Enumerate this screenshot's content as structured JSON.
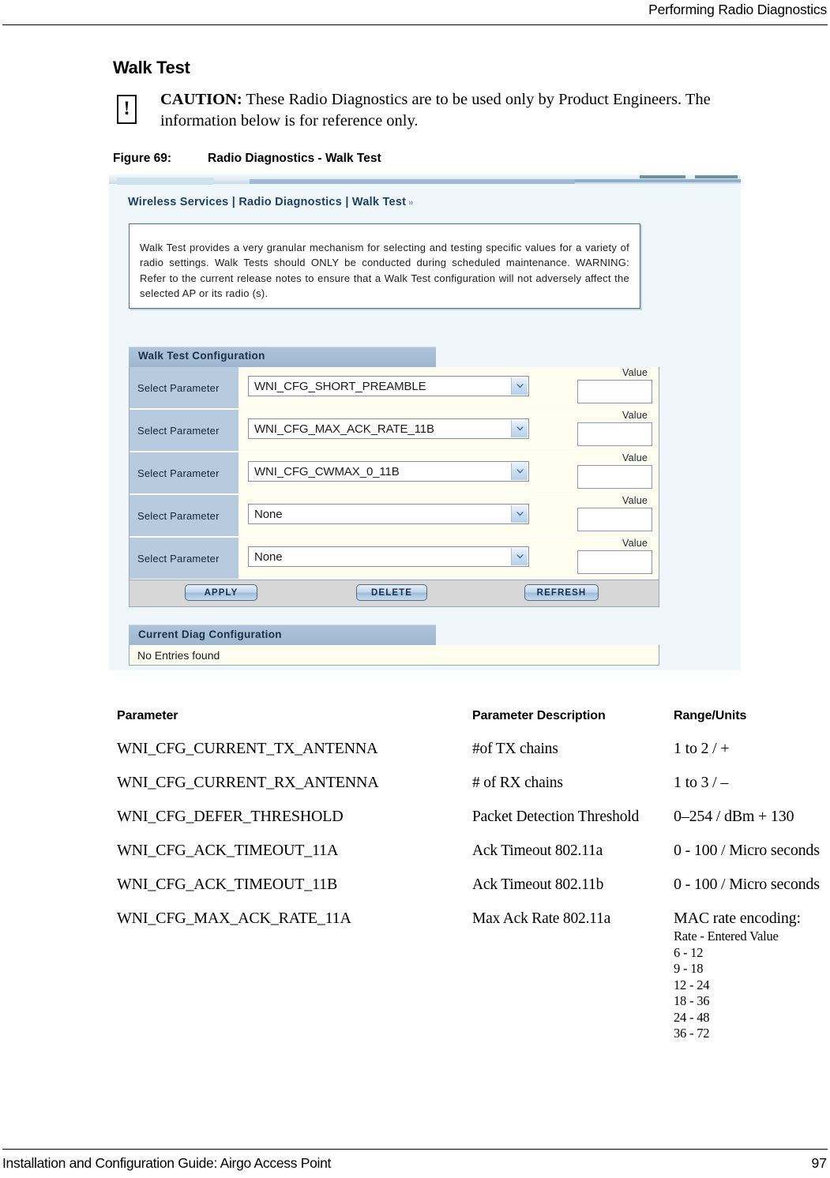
{
  "page": {
    "running_head": "Performing Radio Diagnostics",
    "section_title": "Walk Test",
    "footer_left": "Installation and Configuration Guide: Airgo Access Point",
    "footer_page_number": "97"
  },
  "caution": {
    "icon": "exclamation-icon",
    "glyph": "!",
    "lead": "CAUTION:",
    "body": " These Radio Diagnostics are to be used only by Product Engineers. The information below is for reference only."
  },
  "figure": {
    "number": "Figure 69:",
    "title": "Radio Diagnostics - Walk Test"
  },
  "screenshot": {
    "breadcrumb": "Wireless Services | Radio Diagnostics | Walk Test",
    "breadcrumb_chevron": "»",
    "intro_text": "Walk Test provides a very granular mechanism for selecting and testing specific values for a variety of radio settings. Walk Tests should ONLY be conducted during scheduled maintenance. WARNING: Refer to the current release notes to ensure that a Walk Test configuration will not adversely affect the selected AP or its radio (s).",
    "config_panel": {
      "title": "Walk Test Configuration",
      "value_caption": "Value",
      "rows": [
        {
          "label": "Select Parameter",
          "selected": "WNI_CFG_SHORT_PREAMBLE",
          "value": ""
        },
        {
          "label": "Select Parameter",
          "selected": "WNI_CFG_MAX_ACK_RATE_11B",
          "value": ""
        },
        {
          "label": "Select Parameter",
          "selected": "WNI_CFG_CWMAX_0_11B",
          "value": ""
        },
        {
          "label": "Select Parameter",
          "selected": "None",
          "value": ""
        },
        {
          "label": "Select Parameter",
          "selected": "None",
          "value": ""
        }
      ],
      "buttons": {
        "apply": "APPLY",
        "delete": "DELETE",
        "refresh": "REFRESH"
      }
    },
    "diag_panel": {
      "title": "Current Diag Configuration",
      "empty_message": "No Entries found"
    },
    "colors": {
      "page_background": "#f0f7fb",
      "panel_header": "#a5bed6",
      "row_label": "#b7cade",
      "field_background": "#fffdf0",
      "breadcrumb_text": "#1d3f63",
      "button_border": "#4e6a8c"
    }
  },
  "parameter_table": {
    "headers": [
      "Parameter",
      "Parameter Description",
      "Range/Units"
    ],
    "rows": [
      {
        "parameter": "WNI_CFG_CURRENT_TX_ANTENNA",
        "description": "#of TX chains",
        "range": "1 to 2 / +"
      },
      {
        "parameter": "WNI_CFG_CURRENT_RX_ANTENNA",
        "description": "# of RX chains",
        "range": "1 to 3 / –"
      },
      {
        "parameter": "WNI_CFG_DEFER_THRESHOLD",
        "description": "Packet Detection Threshold",
        "range": "0–254 / dBm + 130"
      },
      {
        "parameter": "WNI_CFG_ACK_TIMEOUT_11A",
        "description": "Ack Timeout 802.11a",
        "range": "0 - 100 / Micro seconds"
      },
      {
        "parameter": "WNI_CFG_ACK_TIMEOUT_11B",
        "description": "Ack Timeout 802.11b",
        "range": "0 - 100 / Micro seconds"
      },
      {
        "parameter": "WNI_CFG_MAX_ACK_RATE_11A",
        "description": "Max Ack Rate 802.11a",
        "range": "MAC rate encoding:",
        "range_detail": "Rate - Entered Value\n6 - 12\n9 - 18\n12 - 24\n18 - 36\n24 - 48\n36 - 72"
      }
    ]
  }
}
